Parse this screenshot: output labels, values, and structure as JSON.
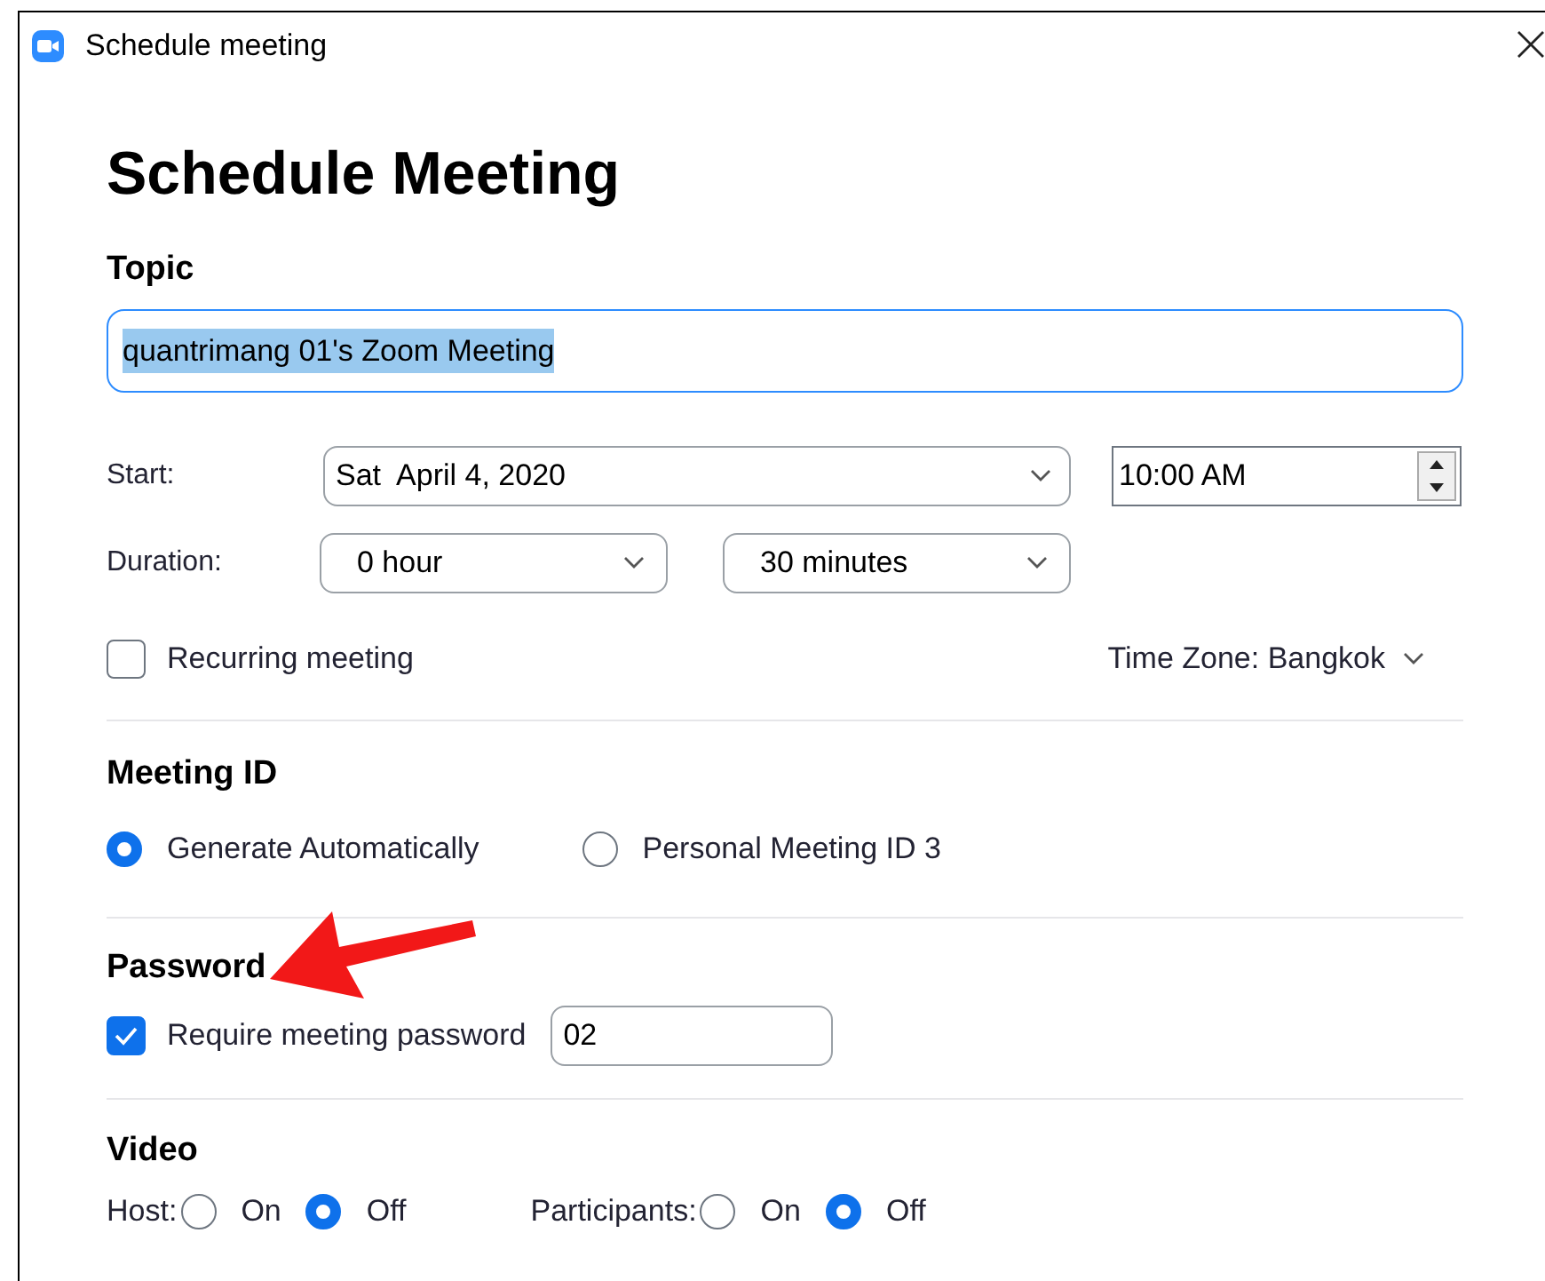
{
  "window": {
    "title": "Schedule meeting"
  },
  "heading": "Schedule Meeting",
  "topic": {
    "label": "Topic",
    "value": "quantrimang 01's Zoom Meeting",
    "text_selected": true
  },
  "start": {
    "label": "Start:",
    "day": "Sat",
    "date": "April 4, 2020",
    "time": "10:00 AM"
  },
  "duration": {
    "label": "Duration:",
    "hours": "0 hour",
    "minutes": "30 minutes"
  },
  "recurring": {
    "label": "Recurring meeting",
    "checked": false
  },
  "time_zone": "Time Zone: Bangkok",
  "meeting_id": {
    "title": "Meeting ID",
    "options": [
      {
        "label": "Generate Automatically",
        "selected": true
      },
      {
        "label": "Personal Meeting ID 3",
        "selected": false
      }
    ]
  },
  "password": {
    "title": "Password",
    "require": {
      "label": "Require meeting password",
      "checked": true
    },
    "value": "02"
  },
  "video": {
    "title": "Video",
    "groups": [
      {
        "label": "Host:",
        "options": [
          {
            "label": "On",
            "selected": false
          },
          {
            "label": "Off",
            "selected": true
          }
        ]
      },
      {
        "label": "Participants:",
        "options": [
          {
            "label": "On",
            "selected": false
          },
          {
            "label": "Off",
            "selected": true
          }
        ]
      }
    ]
  }
}
